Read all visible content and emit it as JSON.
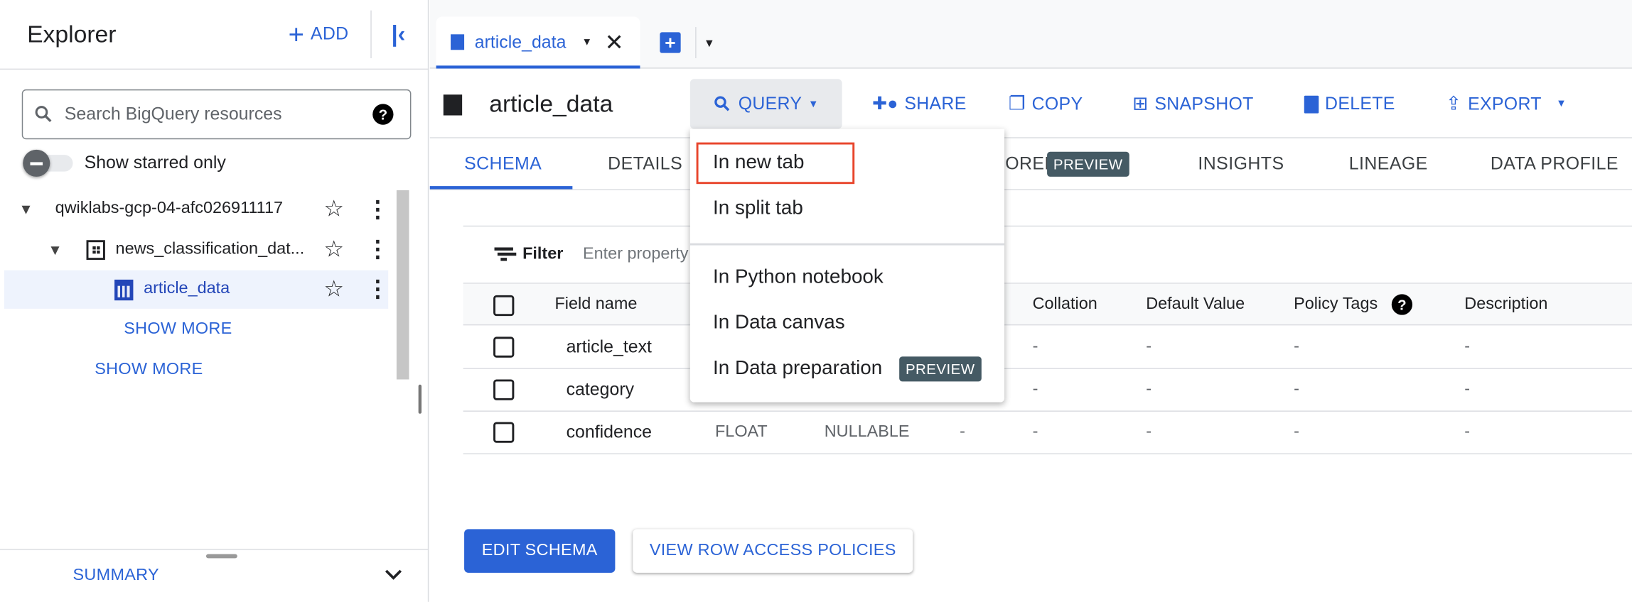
{
  "explorer": {
    "title": "Explorer",
    "add_label": "ADD",
    "search_placeholder": "Search BigQuery resources",
    "show_starred_label": "Show starred only",
    "show_starred_on": false,
    "tree": {
      "project": "qwiklabs-gcp-04-afc026911117",
      "dataset": "news_classification_dat...",
      "table": "article_data",
      "show_more_dataset": "SHOW MORE",
      "show_more_project": "SHOW MORE"
    },
    "summary_label": "SUMMARY"
  },
  "editor_tabs": [
    {
      "label": "article_data",
      "active": true
    }
  ],
  "table_header": {
    "title": "article_data",
    "actions": {
      "query": "QUERY",
      "share": "SHARE",
      "copy": "COPY",
      "snapshot": "SNAPSHOT",
      "delete": "DELETE",
      "export": "EXPORT"
    }
  },
  "detail_tabs": [
    {
      "label": "SCHEMA",
      "active": true
    },
    {
      "label": "DETAILS"
    },
    {
      "label": "TABLE EXPLORER",
      "badge": "PREVIEW"
    },
    {
      "label": "INSIGHTS"
    },
    {
      "label": "LINEAGE"
    },
    {
      "label": "DATA PROFILE"
    }
  ],
  "filter": {
    "label": "Filter",
    "placeholder": "Enter property name or value"
  },
  "schema": {
    "headers": {
      "field_name": "Field name",
      "collation": "Collation",
      "default_value": "Default Value",
      "policy_tags": "Policy Tags",
      "description": "Description"
    },
    "rows": [
      {
        "name": "article_text",
        "type": "",
        "mode": "",
        "key": "",
        "collation": "-",
        "default": "-",
        "policy": "-",
        "description": "-"
      },
      {
        "name": "category",
        "type": "",
        "mode": "",
        "key": "",
        "collation": "-",
        "default": "-",
        "policy": "-",
        "description": "-"
      },
      {
        "name": "confidence",
        "type": "FLOAT",
        "mode": "NULLABLE",
        "key": "-",
        "collation": "-",
        "default": "-",
        "policy": "-",
        "description": "-"
      }
    ]
  },
  "buttons": {
    "edit_schema": "EDIT SCHEMA",
    "view_row_access": "VIEW ROW ACCESS POLICIES"
  },
  "query_menu": {
    "items": [
      {
        "label": "In new tab",
        "highlighted": true
      },
      {
        "label": "In split tab"
      },
      {
        "label": "In Python notebook"
      },
      {
        "label": "In Data canvas"
      },
      {
        "label": "In Data preparation",
        "badge": "PREVIEW"
      }
    ]
  },
  "colors": {
    "accent": "#2b63d6",
    "badge": "#455a64",
    "highlight_border": "#e8452c"
  }
}
